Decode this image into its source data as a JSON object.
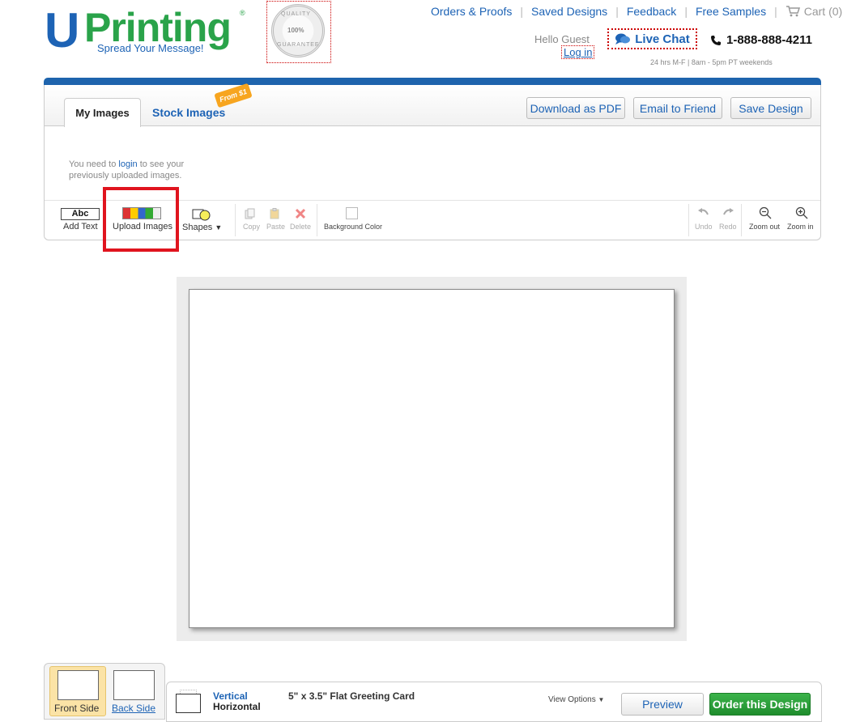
{
  "header": {
    "logo_u": "U",
    "logo_rest": "Printing",
    "logo_reg": "®",
    "tagline": "Spread Your Message!",
    "seal": {
      "top": "QUALITY",
      "middle": "100%",
      "bottom": "GUARANTEE"
    },
    "nav": [
      {
        "label": "Orders & Proofs"
      },
      {
        "label": "Saved Designs"
      },
      {
        "label": "Feedback"
      },
      {
        "label": "Free Samples"
      }
    ],
    "cart_label": "Cart (0)",
    "hello": "Hello Guest",
    "login": "Log in",
    "live_chat": "Live Chat",
    "phone": "1-888-888-4211",
    "hours": "24 hrs M-F | 8am - 5pm PT weekends"
  },
  "panel": {
    "tabs": {
      "my_images": "My Images",
      "stock_images": "Stock Images",
      "badge": "From $1"
    },
    "buttons": {
      "download_pdf": "Download as PDF",
      "email": "Email to Friend",
      "save": "Save Design"
    },
    "login_msg_pre": "You need to ",
    "login_msg_link": "login",
    "login_msg_post": " to see your previously uploaded images."
  },
  "toolbar": {
    "abc": "Abc",
    "add_text": "Add Text",
    "upload_images": "Upload Images",
    "shapes": "Shapes",
    "copy": "Copy",
    "paste": "Paste",
    "delete": "Delete",
    "background_color": "Background Color",
    "undo": "Undo",
    "redo": "Redo",
    "zoom_out": "Zoom out",
    "zoom_in": "Zoom in"
  },
  "bottom": {
    "front_side": "Front Side",
    "back_side": "Back Side",
    "vertical": "Vertical",
    "horizontal": "Horizontal",
    "product": "5\" x 3.5\" Flat Greeting Card",
    "view_options": "View Options",
    "preview": "Preview",
    "order": "Order this Design"
  }
}
